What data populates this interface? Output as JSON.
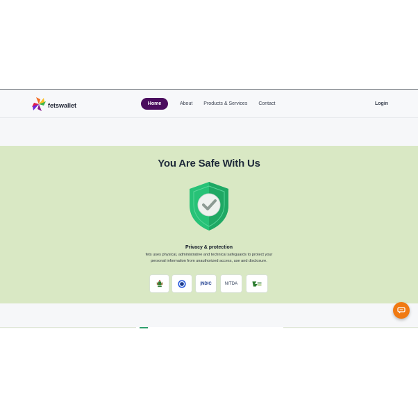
{
  "brand": {
    "name": "fetswallet",
    "logo_icon": "pinwheel-logo-icon"
  },
  "nav": {
    "home": "Home",
    "items": [
      "About",
      "Products & Services",
      "Contact"
    ],
    "login": "Login"
  },
  "hero": {
    "title": "You Are Safe With Us",
    "shield_icon": "shield-check-icon",
    "privacy_title": "Privacy & protection",
    "privacy_text": "fets uses physical, administrative and technical safeguards to protect your personal information from unauthorized access, use and disclosure."
  },
  "badges": [
    {
      "name": "cbn-badge",
      "text": ""
    },
    {
      "name": "iso-badge",
      "text": ""
    },
    {
      "name": "ndic-badge",
      "text": "|NDIC"
    },
    {
      "name": "nitda-badge",
      "text": "NITDA"
    },
    {
      "name": "fbn-badge",
      "text": ""
    }
  ],
  "chat": {
    "icon": "chat-bubble-icon"
  },
  "colors": {
    "nav_active": "#4b0c5e",
    "hero_bg": "#d9e8c4",
    "shield_green": "#27c277",
    "chat_orange": "#f07a12"
  }
}
